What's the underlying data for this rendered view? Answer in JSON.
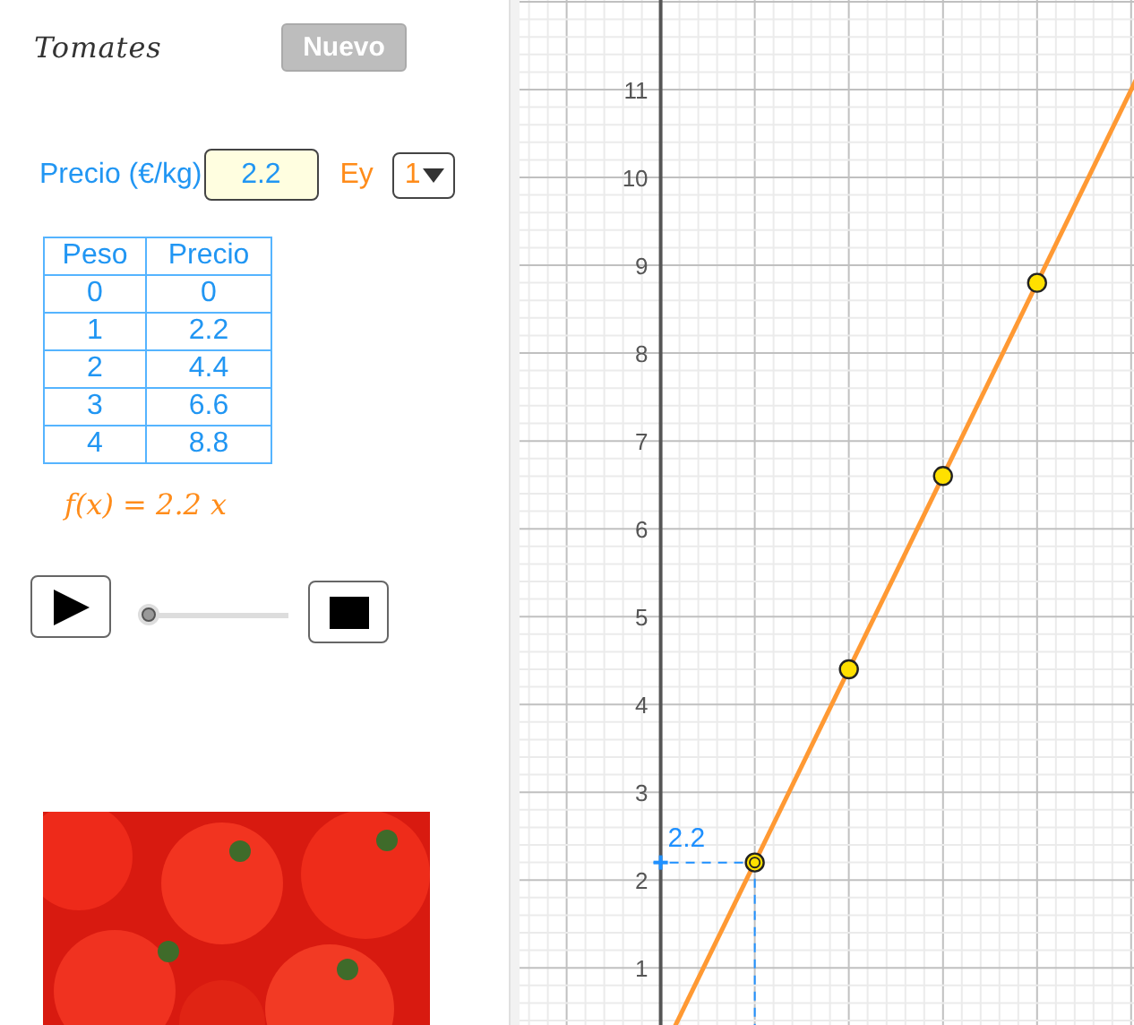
{
  "title": "Tomates",
  "new_button": {
    "label": "Nuevo",
    "disabled": true
  },
  "price": {
    "label": "Precio (€/kg)",
    "value": "2.2"
  },
  "example": {
    "label": "Ey",
    "dropdown": "1"
  },
  "table": {
    "columns": [
      "Peso",
      "Precio"
    ],
    "rows": [
      [
        "0",
        "0"
      ],
      [
        "1",
        "2.2"
      ],
      [
        "2",
        "4.4"
      ],
      [
        "3",
        "6.6"
      ],
      [
        "4",
        "8.8"
      ]
    ]
  },
  "formula": "f(x) = 2.2 x",
  "animation": {
    "level": 0
  },
  "photo": {
    "kind": "photo"
  },
  "graph": {
    "y_axis_labels": [
      "11",
      "10",
      "9",
      "8",
      "7",
      "6",
      "5",
      "4",
      "3",
      "2",
      "1"
    ],
    "points": [
      {
        "selected": true
      },
      {
        "selected": false
      },
      {
        "selected": false
      },
      {
        "selected": false
      }
    ],
    "point_label": "2.2"
  }
}
